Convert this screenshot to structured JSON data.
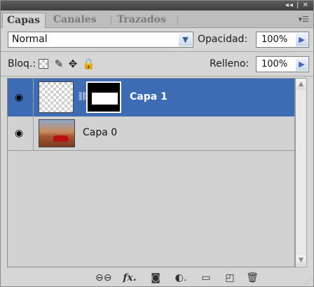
{
  "window": {
    "controls": "◂◂ | ✕"
  },
  "tabs": [
    {
      "label": "Capas"
    },
    {
      "label": "Canales"
    },
    {
      "label": "Trazados"
    }
  ],
  "blend": {
    "value": "Normal"
  },
  "opacity": {
    "label": "Opacidad:",
    "value": "100%"
  },
  "lock": {
    "label": "Bloq.:"
  },
  "fill": {
    "label": "Relleno:",
    "value": "100%"
  },
  "layers": [
    {
      "name": "Capa 1",
      "selected": true,
      "visible": true,
      "has_mask": true
    },
    {
      "name": "Capa 0",
      "selected": false,
      "visible": true,
      "has_mask": false
    }
  ],
  "colors": {
    "selection": "#3d6bb4",
    "panel": "#d6d6d6"
  },
  "footer_icons": [
    "link-layers-icon",
    "fx-icon",
    "add-mask-icon",
    "adjustment-layer-icon",
    "new-group-icon",
    "new-layer-icon",
    "delete-icon"
  ]
}
